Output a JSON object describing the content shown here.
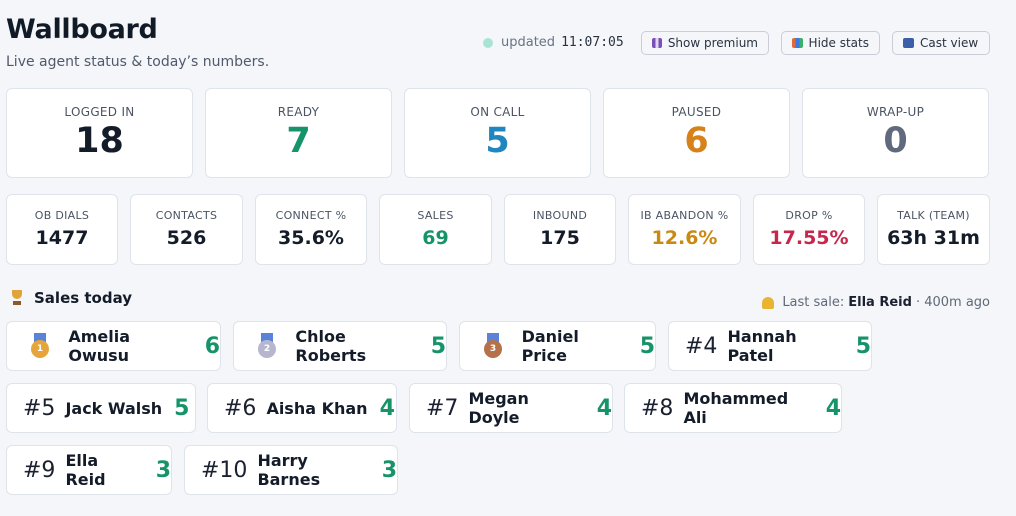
{
  "header": {
    "title": "Wallboard",
    "subtitle": "Live agent status & today’s numbers.",
    "updated_label": "updated",
    "updated_time": "11:07:05"
  },
  "toolbar": {
    "premium_label": "Show premium",
    "stats_label": "Hide stats",
    "cast_label": "Cast view"
  },
  "status_cards": [
    {
      "label": "LOGGED IN",
      "value": "18",
      "color": "#141c2a"
    },
    {
      "label": "READY",
      "value": "7",
      "color": "#17936a"
    },
    {
      "label": "ON CALL",
      "value": "5",
      "color": "#1f86c0"
    },
    {
      "label": "PAUSED",
      "value": "6",
      "color": "#d6811a"
    },
    {
      "label": "WRAP-UP",
      "value": "0",
      "color": "#5f6b7c"
    }
  ],
  "stat_cards": [
    {
      "label": "OB DIALS",
      "value": "1477"
    },
    {
      "label": "CONTACTS",
      "value": "526"
    },
    {
      "label": "CONNECT %",
      "value": "35.6%"
    },
    {
      "label": "SALES",
      "value": "69"
    },
    {
      "label": "INBOUND",
      "value": "175"
    },
    {
      "label": "IB ABANDON %",
      "value": "12.6%"
    },
    {
      "label": "DROP %",
      "value": "17.55%"
    },
    {
      "label": "TALK (TEAM)",
      "value": "63h 31m"
    }
  ],
  "sales": {
    "title": "Sales today",
    "last_sale_prefix": "Last sale:",
    "last_sale_name": "Ella Reid",
    "last_sale_ago": "· 400m ago",
    "leaders": [
      {
        "medal": "1",
        "name": "Amelia Owusu",
        "count": "6"
      },
      {
        "medal": "2",
        "name": "Chloe Roberts",
        "count": "5"
      },
      {
        "medal": "3",
        "name": "Daniel Price",
        "count": "5"
      },
      {
        "rank": "#4",
        "name": "Hannah Patel",
        "count": "5"
      },
      {
        "rank": "#5",
        "name": "Jack Walsh",
        "count": "5"
      },
      {
        "rank": "#6",
        "name": "Aisha Khan",
        "count": "4"
      },
      {
        "rank": "#7",
        "name": "Megan Doyle",
        "count": "4"
      },
      {
        "rank": "#8",
        "name": "Mohammed Ali",
        "count": "4"
      },
      {
        "rank": "#9",
        "name": "Ella Reid",
        "count": "3"
      },
      {
        "rank": "#10",
        "name": "Harry Barnes",
        "count": "3"
      }
    ]
  }
}
